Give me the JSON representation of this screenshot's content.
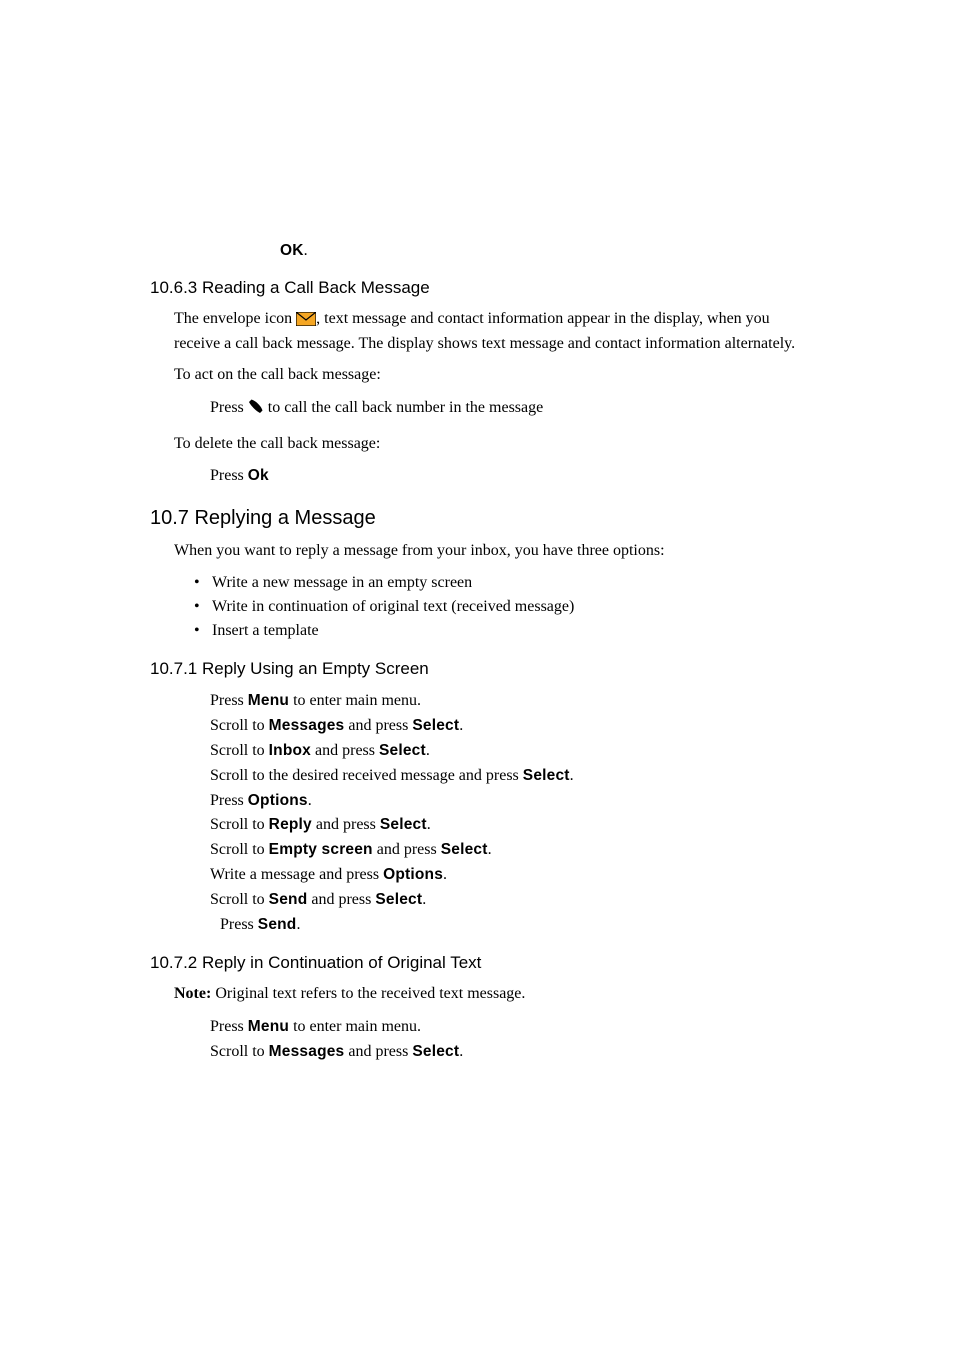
{
  "top": {
    "ok": "OK"
  },
  "sec_10_6_3": {
    "heading": "10.6.3  Reading a Call Back Message",
    "p1_a": "The envelope icon ",
    "p1_b": ", text message and contact information appear in the display, when you receive a call back message. The display shows text message and contact information alternately.",
    "act_intro": "To act on the call back message:",
    "act_press": "Press ",
    "act_press_rest": "  to call the call back number in the message",
    "del_intro": "To delete the call back message:",
    "del_press_pre": "Press ",
    "del_press_label": "Ok"
  },
  "sec_10_7": {
    "heading": "10.7  Replying a Message",
    "intro": "When you want to reply a message from your inbox, you have three options:",
    "bullets": [
      "Write a new message in an empty screen",
      "Write in continuation of original text (received message)",
      "Insert a template"
    ]
  },
  "sec_10_7_1": {
    "heading": "10.7.1  Reply Using an Empty Screen",
    "lines": [
      {
        "pre": "Press ",
        "b1": "Menu",
        "mid": " to enter main menu.",
        "b2": "",
        "post": ""
      },
      {
        "pre": "Scroll to ",
        "b1": "Messages",
        "mid": " and press ",
        "b2": "Select",
        "post": "."
      },
      {
        "pre": "Scroll to ",
        "b1": "Inbox",
        "mid": " and press ",
        "b2": "Select",
        "post": "."
      },
      {
        "pre": "Scroll to the desired received message and press ",
        "b1": "Select",
        "mid": ".",
        "b2": "",
        "post": ""
      },
      {
        "pre": "Press ",
        "b1": "Options",
        "mid": ".",
        "b2": "",
        "post": ""
      },
      {
        "pre": "Scroll to ",
        "b1": "Reply",
        "mid": " and press ",
        "b2": "Select",
        "post": "."
      },
      {
        "pre": "Scroll to ",
        "b1": "Empty screen",
        "mid": " and press ",
        "b2": "Select",
        "post": "."
      },
      {
        "pre": "Write a message and press ",
        "b1": "Options",
        "mid": ".",
        "b2": "",
        "post": ""
      },
      {
        "pre": "Scroll to ",
        "b1": "Send",
        "mid": " and press ",
        "b2": "Select",
        "post": "."
      }
    ],
    "last_pre": "Press ",
    "last_b": "Send",
    "last_post": "."
  },
  "sec_10_7_2": {
    "heading": "10.7.2  Reply in Continuation of Original Text",
    "note_label": "Note:",
    "note_text": " Original text refers to the received text message.",
    "lines": [
      {
        "pre": "Press ",
        "b1": "Menu",
        "mid": " to enter main menu.",
        "b2": "",
        "post": ""
      },
      {
        "pre": "Scroll to ",
        "b1": "Messages",
        "mid": " and press ",
        "b2": "Select",
        "post": "."
      }
    ]
  }
}
